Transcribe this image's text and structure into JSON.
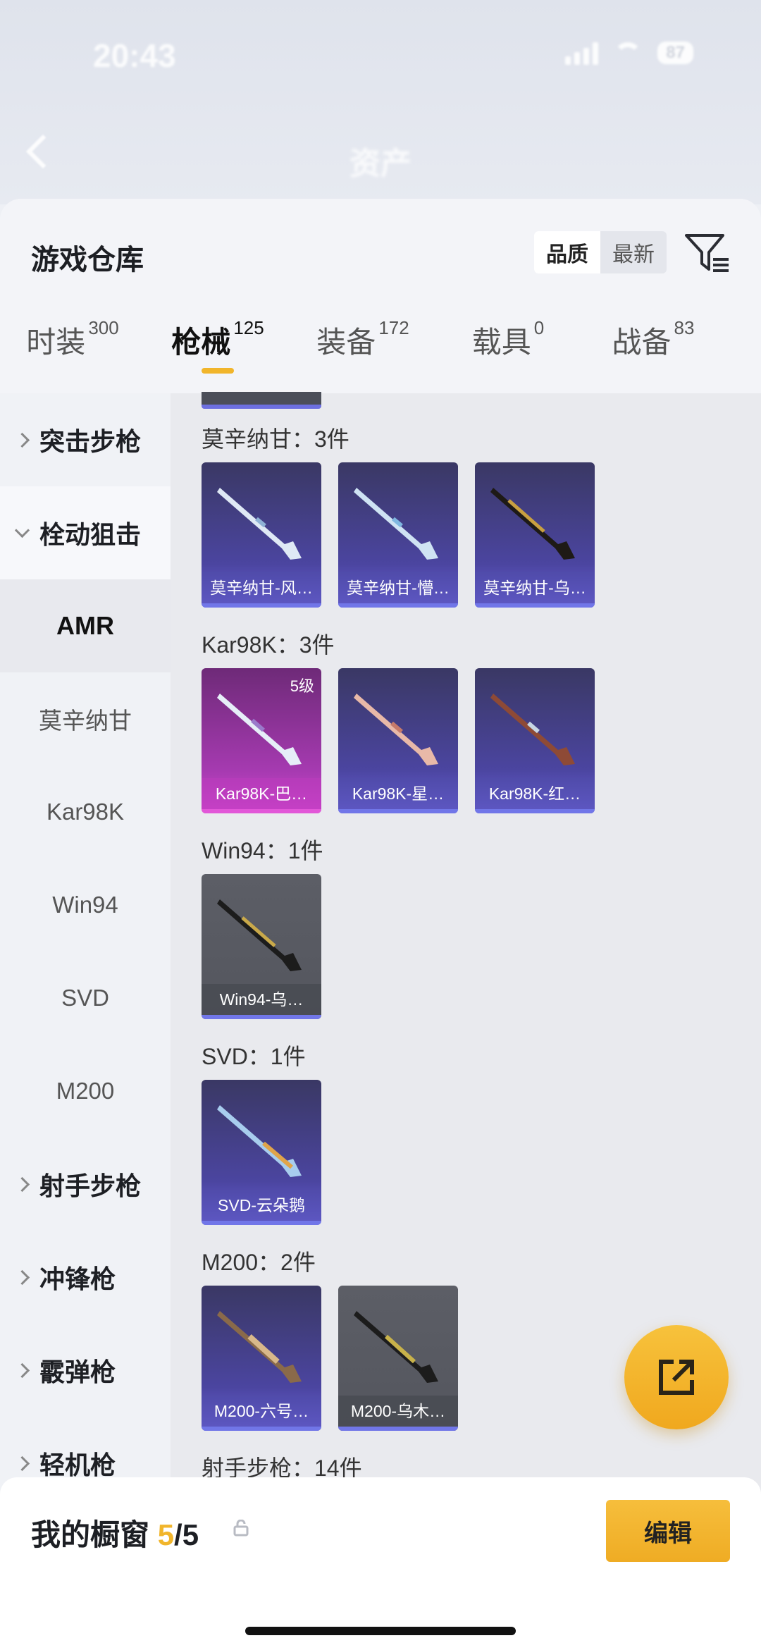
{
  "status": {
    "time": "20:43",
    "battery": "87"
  },
  "nav": {
    "title": "资产"
  },
  "panel": {
    "title": "游戏仓库",
    "sort_options": [
      "品质",
      "最新"
    ],
    "sort_selected": "品质"
  },
  "tabs": [
    {
      "label": "时装",
      "count": "300"
    },
    {
      "label": "枪械",
      "count": "125"
    },
    {
      "label": "装备",
      "count": "172"
    },
    {
      "label": "载具",
      "count": "0"
    },
    {
      "label": "战备",
      "count": "83"
    }
  ],
  "sidebar": {
    "cat_assault": "突击步枪",
    "cat_bolt": "栓动狙击",
    "sub_amr": "AMR",
    "sub_mosin": "莫辛纳甘",
    "sub_kar98k": "Kar98K",
    "sub_win94": "Win94",
    "sub_svd": "SVD",
    "sub_m200": "M200",
    "cat_marksman": "射手步枪",
    "cat_smg": "冲锋枪",
    "cat_shotgun": "霰弹枪",
    "cat_lmg": "轻机枪"
  },
  "groups": {
    "mosin": {
      "label": "莫辛纳甘：3件",
      "items": [
        "莫辛纳甘-风…",
        "莫辛纳甘-懵…",
        "莫辛纳甘-乌…"
      ]
    },
    "kar98k": {
      "label": "Kar98K：3件",
      "items": [
        "Kar98K-巴…",
        "Kar98K-星…",
        "Kar98K-红…"
      ],
      "level": "5级"
    },
    "win94": {
      "label": "Win94：1件",
      "items": [
        "Win94-乌…"
      ]
    },
    "svd": {
      "label": "SVD：1件",
      "items": [
        "SVD-云朵鹅"
      ]
    },
    "m200": {
      "label": "M200：2件",
      "items": [
        "M200-六号…",
        "M200-乌木…"
      ]
    },
    "marksman": {
      "label": "射手步枪：14件"
    }
  },
  "bottom": {
    "title": "我的橱窗",
    "count_now": "5",
    "count_sep": "/",
    "count_max": "5",
    "edit_label": "编辑"
  },
  "colors": {
    "accent": "#f1b52b",
    "card_purple": "#4b45a0",
    "card_pink": "#a53ab0",
    "card_grey": "#5c5e66"
  }
}
